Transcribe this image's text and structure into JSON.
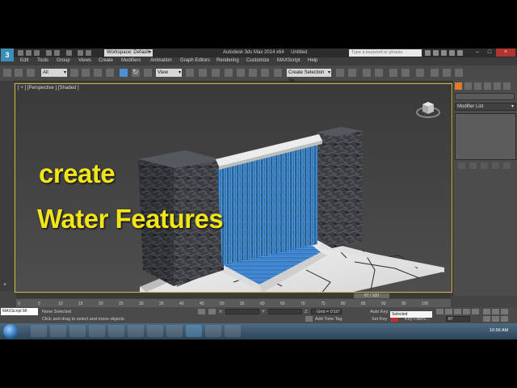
{
  "window": {
    "title": "Autodesk 3ds Max  2014 x64",
    "document": "Untitled",
    "workspace": "Workspace: Default",
    "search_placeholder": "Type a keyword or phrase"
  },
  "menu": [
    "Edit",
    "Tools",
    "Group",
    "Views",
    "Create",
    "Modifiers",
    "Animation",
    "Graph Editors",
    "Rendering",
    "Customize",
    "MAXScript",
    "Help"
  ],
  "toolbar": {
    "filter": "All",
    "coord": "View",
    "named_sel": "Create Selection Se..."
  },
  "viewport": {
    "label": "[ + ] [Perspective ] [Shaded ]",
    "overlay_line1": "create",
    "overlay_line2": "Water Features"
  },
  "command_panel": {
    "modifier_list": "Modifier List"
  },
  "timeline": {
    "frame": "87 / 100",
    "ticks": [
      "0",
      "5",
      "10",
      "15",
      "20",
      "25",
      "30",
      "35",
      "40",
      "45",
      "50",
      "55",
      "60",
      "65",
      "70",
      "75",
      "80",
      "85",
      "90",
      "95",
      "100"
    ]
  },
  "status": {
    "maxscript": "MAXScript Mi:",
    "none_selected": "None Selected",
    "prompt": "Click and drag to select and move objects",
    "x_label": "X:",
    "y_label": "Y:",
    "z_label": "Z:",
    "grid": "Grid = 0'10\"",
    "add_time_tag": "Add Time Tag",
    "auto_key": "Auto Key",
    "auto_key_value": "Selected",
    "set_key": "Set Key",
    "key_filters": "Key Filters...",
    "current_frame": "87"
  },
  "taskbar": {
    "clock": "10:56 AM"
  },
  "colors": {
    "overlay": "#f2e41b",
    "viewport_border": "#d8b43a",
    "water": "#3f8fd8"
  }
}
